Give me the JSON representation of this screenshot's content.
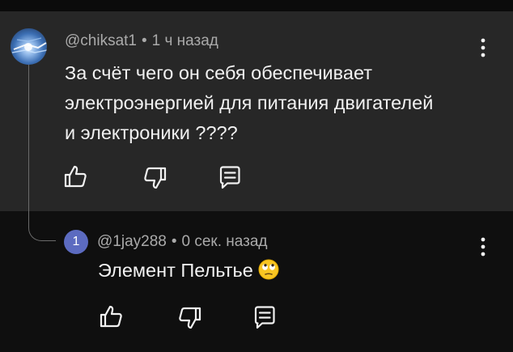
{
  "comment": {
    "author": "@chiksat1",
    "separator": "•",
    "time": "1 ч назад",
    "lines": [
      "За счёт чего он себя обеспечивает",
      "электроэнергией для питания двигателей",
      "и электроники ????"
    ]
  },
  "reply": {
    "avatar_letter": "1",
    "avatar_color": "#5c6bc0",
    "author": "@1jay288",
    "separator": "•",
    "time": "0 сек. назад",
    "text": "Элемент Пельтье",
    "emoji": "face-with-rolling-eyes"
  },
  "icons": {
    "like": "thumbs-up-icon",
    "dislike": "thumbs-down-icon",
    "reply": "reply-comment-icon",
    "menu": "more-vertical-icon"
  }
}
